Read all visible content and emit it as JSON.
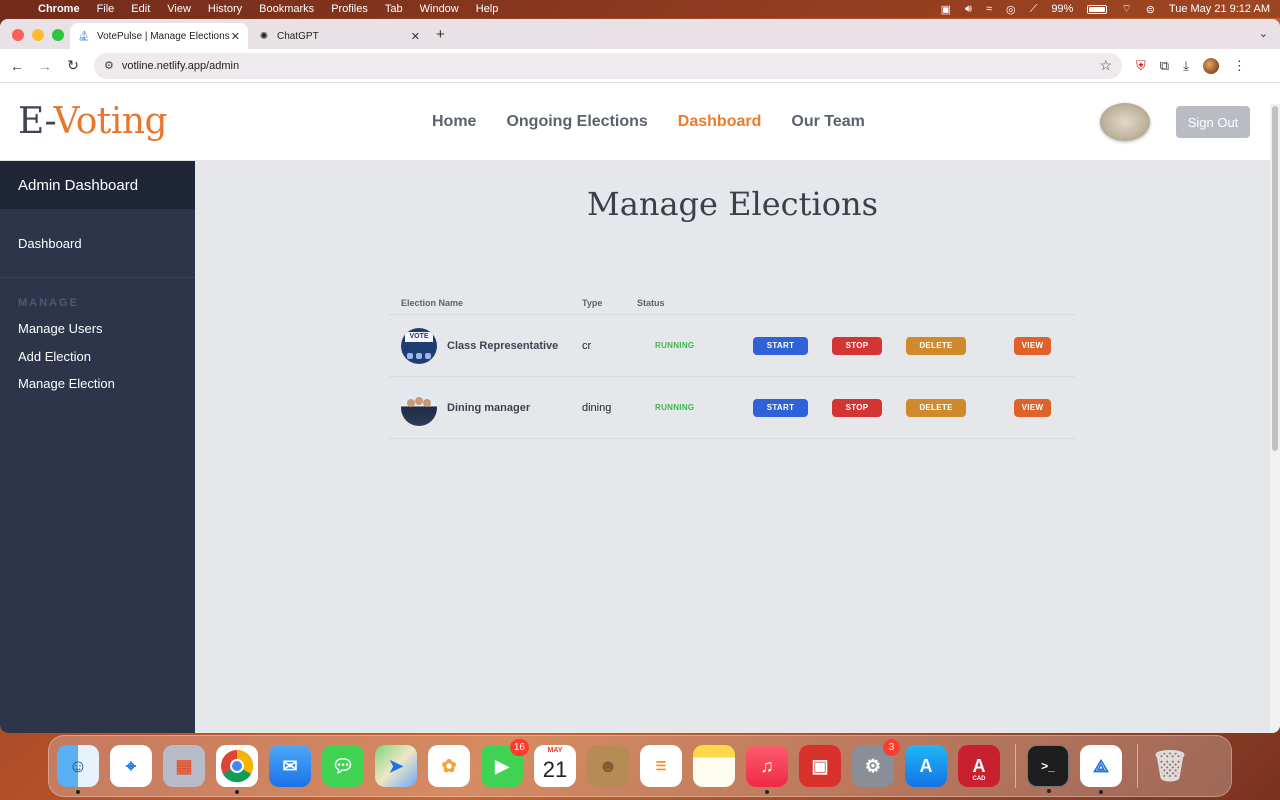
{
  "menubar": {
    "app": "Chrome",
    "items": [
      "File",
      "Edit",
      "View",
      "History",
      "Bookmarks",
      "Profiles",
      "Tab",
      "Window",
      "Help"
    ],
    "battery": "99%",
    "datetime": "Tue May 21  9:12 AM"
  },
  "browser": {
    "tabs": [
      {
        "title": "VotePulse | Manage Elections",
        "icon": "votepulse-favicon"
      },
      {
        "title": "ChatGPT",
        "icon": "chatgpt-favicon"
      }
    ],
    "url": "votline.netlify.app/admin",
    "extension_badge": "1"
  },
  "site": {
    "logo_prefix": "E-",
    "logo_suffix": "Voting",
    "nav": [
      {
        "label": "Home",
        "active": false
      },
      {
        "label": "Ongoing Elections",
        "active": false
      },
      {
        "label": "Dashboard",
        "active": true
      },
      {
        "label": "Our Team",
        "active": false
      }
    ],
    "signout_label": "Sign Out",
    "colors": {
      "accent": "#ea7d2d",
      "sidebar": "#2c3549",
      "sidebar_head": "#1f2737",
      "main_bg": "#e5e7eb"
    }
  },
  "sidebar": {
    "title": "Admin Dashboard",
    "dashboard": "Dashboard",
    "section": "MANAGE",
    "links": [
      "Manage Users",
      "Add Election",
      "Manage Election"
    ]
  },
  "page": {
    "title": "Manage Elections",
    "columns": [
      "Election Name",
      "Type",
      "Status"
    ],
    "rows": [
      {
        "name": "Class Representative",
        "type": "cr",
        "status": "RUNNING",
        "image": "vote-poster"
      },
      {
        "name": "Dining manager",
        "type": "dining",
        "status": "RUNNING",
        "image": "group-photo"
      }
    ],
    "actions": {
      "start": "START",
      "stop": "STOP",
      "delete": "DELETE",
      "view": "VIEW"
    }
  },
  "dock": {
    "apps": [
      "Finder",
      "Safari",
      "Launchpad",
      "Chrome",
      "Mail",
      "Messages",
      "Maps",
      "Photos",
      "FaceTime",
      "Calendar",
      "Contacts",
      "Reminders",
      "Notes",
      "Music",
      "Photo Booth",
      "System Settings",
      "App Store",
      "AutoCAD",
      "Terminal",
      "Instruments",
      "Trash"
    ],
    "facetime_badge": "16",
    "settings_badge": "3",
    "calendar_month": "MAY",
    "calendar_day": "21",
    "cad_label": "CAD",
    "cad_letter": "A"
  }
}
